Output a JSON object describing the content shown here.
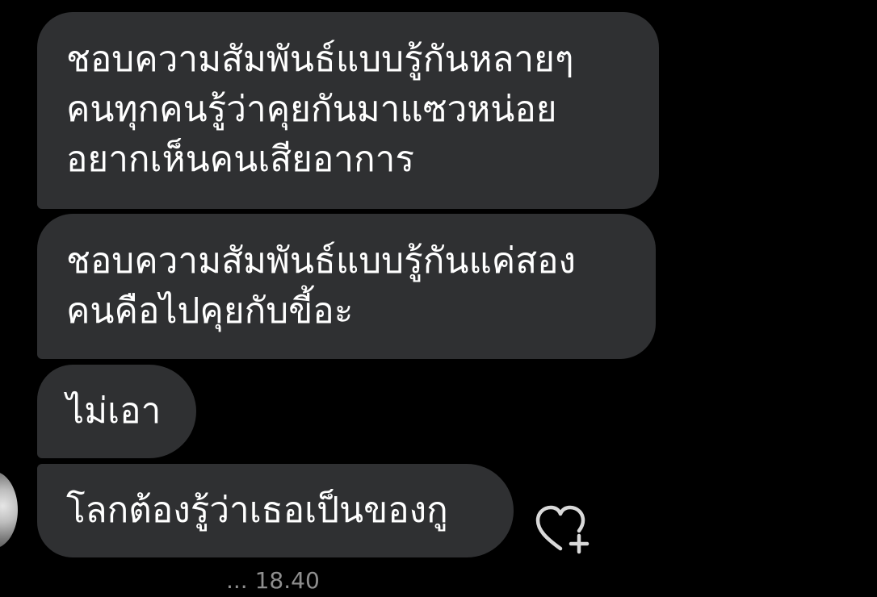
{
  "messages": [
    {
      "lines": [
        "ชอบความสัมพันธ์แบบรู้กันหลายๆ",
        "คนทุกคนรู้ว่าคุยกันมาแซวหน่อย",
        "อยากเห็นคนเสียอาการ"
      ]
    },
    {
      "lines": [
        "ชอบความสัมพันธ์แบบรู้กันแค่สอง",
        "คนคือไปคุยกับขี้อะ"
      ]
    },
    {
      "lines": [
        "ไม่เอา"
      ]
    },
    {
      "lines": [
        "โลกต้องรู้ว่าเธอเป็นของกู"
      ]
    }
  ],
  "footer": {
    "timestamp": "... 18.40"
  },
  "icons": {
    "reaction": "heart-plus-icon",
    "avatar": "avatar"
  },
  "colors": {
    "background": "#000000",
    "bubble": "#2f3032",
    "text": "#ffffff",
    "icon": "#d9d9d9"
  }
}
